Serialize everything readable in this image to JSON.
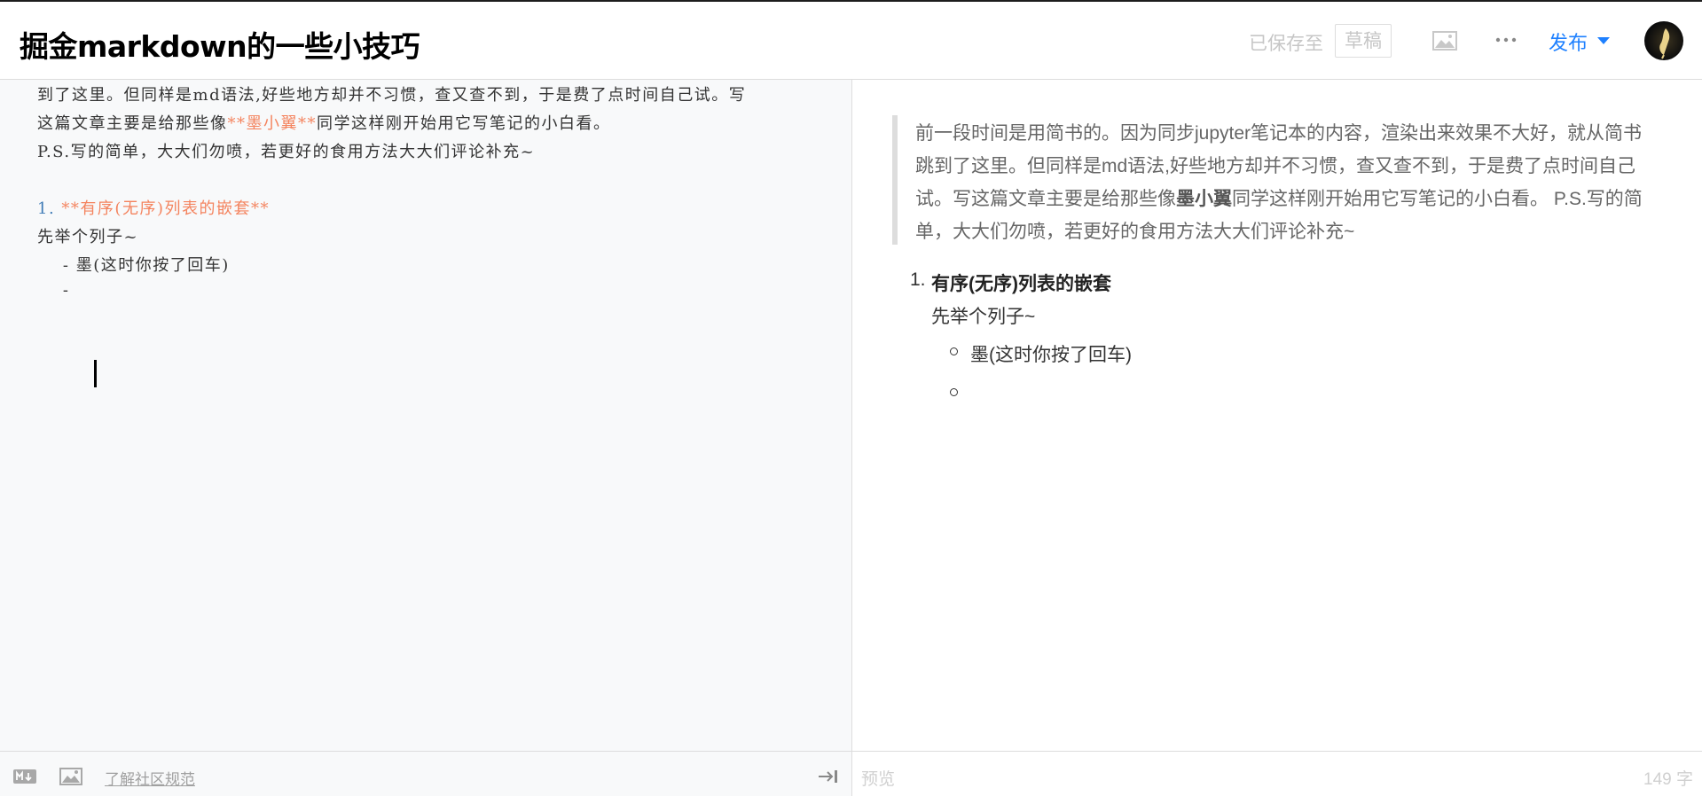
{
  "header": {
    "title": "掘金markdown的一些小技巧",
    "saved_text": "已保存至",
    "draft_label": "草稿",
    "publish_label": "发布",
    "icons": [
      "image-icon",
      "more-icon",
      "caret-down-icon",
      "avatar"
    ]
  },
  "editor": {
    "lines": [
      "到了这里。但同样是md语法,好些地方却并不习惯，查又查不到，于是费了点时间自己试。写",
      "这篇文章主要是给那些像",
      "**墨小翼**",
      "同学这样刚开始用它写笔记的小白看。",
      "P.S.写的简单，大大们勿喷，若更好的食用方法大大们评论补充~",
      "1.",
      "**有序(无序)列表的嵌套**",
      "先举个列子~",
      "    - 墨(这时你按了回车)",
      "    - "
    ]
  },
  "preview": {
    "quote_segments": [
      "前一段时间是用简书的。因为同步jupyter笔记本的内容，渲染出来效果不大好，就从简书跳到了这里。但同样是md语法,好些地方却并不习惯，查又查不到，于是费了点时间自己试。写这篇文章主要是给那些像",
      "墨小翼",
      "同学这样刚开始用它写笔记的小白看。 P.S.写的简单，大大们勿喷，若更好的食用方法大大们评论补充~"
    ],
    "list_number": "1.",
    "list_heading": "有序(无序)列表的嵌套",
    "list_sub": "先举个列子~",
    "bullet_items": [
      "墨(这时你按了回车)",
      ""
    ]
  },
  "footer": {
    "rules_link": "了解社区规范",
    "preview_label": "预览",
    "word_count": "149 字"
  },
  "colors": {
    "accent": "#1e80ff",
    "markdown_emphasis": "#f4845f",
    "list_marker": "#3f7bb6"
  }
}
